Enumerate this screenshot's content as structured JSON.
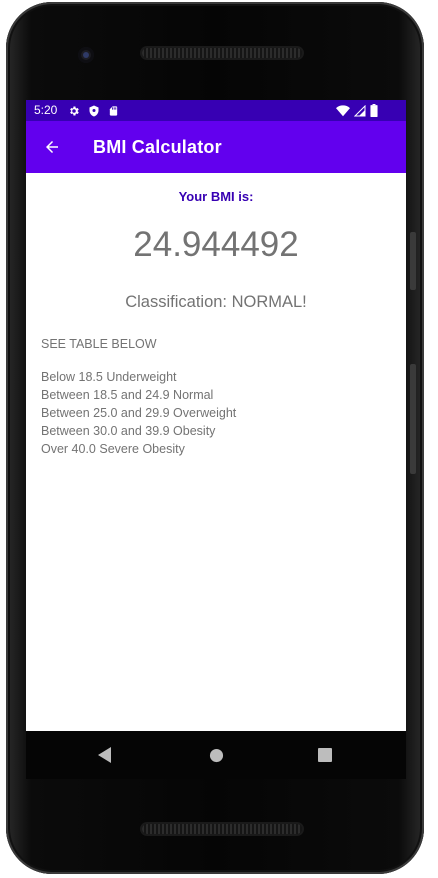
{
  "status_bar": {
    "time": "5:20",
    "left_icons": [
      "settings-gear-icon",
      "shield-icon",
      "sd-card-icon"
    ],
    "right_icons": [
      "wifi-icon",
      "cell-signal-icon",
      "battery-icon"
    ]
  },
  "app_bar": {
    "back_icon": "arrow-left-icon",
    "title": "BMI Calculator"
  },
  "result": {
    "heading": "Your BMI is:",
    "value": "24.944492",
    "classification": "Classification: NORMAL!"
  },
  "table": {
    "note": "SEE TABLE BELOW",
    "ranges": [
      "Below 18.5 Underweight",
      "Between 18.5 and 24.9 Normal",
      "Between 25.0 and 29.9 Overweight",
      "Between 30.0 and 39.9 Obesity",
      "Over 40.0 Severe Obesity"
    ]
  },
  "nav_bar": {
    "icons": [
      "nav-back-icon",
      "nav-home-icon",
      "nav-recents-icon"
    ]
  },
  "colors": {
    "status_bar": "#3700b3",
    "app_bar": "#6200ee",
    "heading": "#3700b3",
    "body_text": "#737373"
  }
}
